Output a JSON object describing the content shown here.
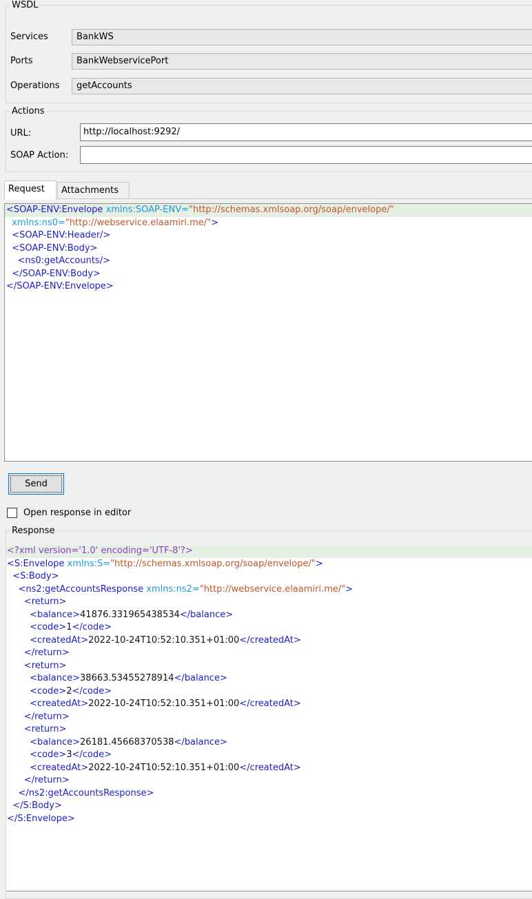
{
  "wsdl": {
    "legend": "WSDL",
    "services_label": "Services",
    "services_value": "BankWS",
    "ports_label": "Ports",
    "ports_value": "BankWebservicePort",
    "operations_label": "Operations",
    "operations_value": "getAccounts"
  },
  "actions": {
    "legend": "Actions",
    "url_label": "URL:",
    "url_value": "http://localhost:9292/",
    "soap_action_label": "SOAP Action:",
    "soap_action_value": ""
  },
  "tabs": [
    {
      "label": "Request",
      "selected": true
    },
    {
      "label": "Attachments",
      "selected": false
    }
  ],
  "request": {
    "lines": [
      [
        {
          "t": "tg",
          "v": "<SOAP-ENV:Envelope "
        },
        {
          "t": "at",
          "v": "xmlns:SOAP-ENV="
        },
        {
          "t": "vl",
          "v": "\"http://schemas.xmlsoap.org/soap/envelope/\""
        }
      ],
      [
        {
          "t": "tx",
          "v": "  "
        },
        {
          "t": "at",
          "v": "xmlns:ns0="
        },
        {
          "t": "vl",
          "v": "\"http://webservice.elaamiri.me/\""
        },
        {
          "t": "tg",
          "v": ">"
        }
      ],
      [
        {
          "t": "tx",
          "v": "  "
        },
        {
          "t": "tg",
          "v": "<SOAP-ENV:Header/>"
        }
      ],
      [
        {
          "t": "tx",
          "v": "  "
        },
        {
          "t": "tg",
          "v": "<SOAP-ENV:Body>"
        }
      ],
      [
        {
          "t": "tx",
          "v": "    "
        },
        {
          "t": "tg",
          "v": "<ns0:getAccounts/>"
        }
      ],
      [
        {
          "t": "tx",
          "v": "  "
        },
        {
          "t": "tg",
          "v": "</SOAP-ENV:Body>"
        }
      ],
      [
        {
          "t": "tg",
          "v": "</SOAP-ENV:Envelope>"
        }
      ]
    ]
  },
  "send_button": "Send",
  "open_in_editor": {
    "label": "Open response in editor",
    "checked": false
  },
  "response": {
    "legend": "Response",
    "lines": [
      [
        {
          "t": "pi",
          "v": "<?xml version='1.0' encoding='UTF-8'?>"
        }
      ],
      [
        {
          "t": "tg",
          "v": "<S:Envelope "
        },
        {
          "t": "at",
          "v": "xmlns:S="
        },
        {
          "t": "vl",
          "v": "\"http://schemas.xmlsoap.org/soap/envelope/\""
        },
        {
          "t": "tg",
          "v": ">"
        }
      ],
      [
        {
          "t": "tx",
          "v": "  "
        },
        {
          "t": "tg",
          "v": "<S:Body>"
        }
      ],
      [
        {
          "t": "tx",
          "v": "    "
        },
        {
          "t": "tg",
          "v": "<ns2:getAccountsResponse "
        },
        {
          "t": "at",
          "v": "xmlns:ns2="
        },
        {
          "t": "vl",
          "v": "\"http://webservice.elaamiri.me/\""
        },
        {
          "t": "tg",
          "v": ">"
        }
      ],
      [
        {
          "t": "tx",
          "v": "      "
        },
        {
          "t": "tg",
          "v": "<return>"
        }
      ],
      [
        {
          "t": "tx",
          "v": "        "
        },
        {
          "t": "tg",
          "v": "<balance>"
        },
        {
          "t": "tx",
          "v": "41876.331965438534"
        },
        {
          "t": "tg",
          "v": "</balance>"
        }
      ],
      [
        {
          "t": "tx",
          "v": "        "
        },
        {
          "t": "tg",
          "v": "<code>"
        },
        {
          "t": "tx",
          "v": "1"
        },
        {
          "t": "tg",
          "v": "</code>"
        }
      ],
      [
        {
          "t": "tx",
          "v": "        "
        },
        {
          "t": "tg",
          "v": "<createdAt>"
        },
        {
          "t": "tx",
          "v": "2022-10-24T10:52:10.351+01:00"
        },
        {
          "t": "tg",
          "v": "</createdAt>"
        }
      ],
      [
        {
          "t": "tx",
          "v": "      "
        },
        {
          "t": "tg",
          "v": "</return>"
        }
      ],
      [
        {
          "t": "tx",
          "v": "      "
        },
        {
          "t": "tg",
          "v": "<return>"
        }
      ],
      [
        {
          "t": "tx",
          "v": "        "
        },
        {
          "t": "tg",
          "v": "<balance>"
        },
        {
          "t": "tx",
          "v": "38663.53455278914"
        },
        {
          "t": "tg",
          "v": "</balance>"
        }
      ],
      [
        {
          "t": "tx",
          "v": "        "
        },
        {
          "t": "tg",
          "v": "<code>"
        },
        {
          "t": "tx",
          "v": "2"
        },
        {
          "t": "tg",
          "v": "</code>"
        }
      ],
      [
        {
          "t": "tx",
          "v": "        "
        },
        {
          "t": "tg",
          "v": "<createdAt>"
        },
        {
          "t": "tx",
          "v": "2022-10-24T10:52:10.351+01:00"
        },
        {
          "t": "tg",
          "v": "</createdAt>"
        }
      ],
      [
        {
          "t": "tx",
          "v": "      "
        },
        {
          "t": "tg",
          "v": "</return>"
        }
      ],
      [
        {
          "t": "tx",
          "v": "      "
        },
        {
          "t": "tg",
          "v": "<return>"
        }
      ],
      [
        {
          "t": "tx",
          "v": "        "
        },
        {
          "t": "tg",
          "v": "<balance>"
        },
        {
          "t": "tx",
          "v": "26181.45668370538"
        },
        {
          "t": "tg",
          "v": "</balance>"
        }
      ],
      [
        {
          "t": "tx",
          "v": "        "
        },
        {
          "t": "tg",
          "v": "<code>"
        },
        {
          "t": "tx",
          "v": "3"
        },
        {
          "t": "tg",
          "v": "</code>"
        }
      ],
      [
        {
          "t": "tx",
          "v": "        "
        },
        {
          "t": "tg",
          "v": "<createdAt>"
        },
        {
          "t": "tx",
          "v": "2022-10-24T10:52:10.351+01:00"
        },
        {
          "t": "tg",
          "v": "</createdAt>"
        }
      ],
      [
        {
          "t": "tx",
          "v": "      "
        },
        {
          "t": "tg",
          "v": "</return>"
        }
      ],
      [
        {
          "t": "tx",
          "v": "    "
        },
        {
          "t": "tg",
          "v": "</ns2:getAccountsResponse>"
        }
      ],
      [
        {
          "t": "tx",
          "v": "  "
        },
        {
          "t": "tg",
          "v": "</S:Body>"
        }
      ],
      [
        {
          "t": "tg",
          "v": "</S:Envelope>"
        }
      ]
    ]
  },
  "colors": {
    "tag": "#1c1cc6",
    "attribute": "#1e9bd0",
    "value": "#c0562a",
    "processing_instruction": "#8a3fbf",
    "current_line_highlight": "#e6efe3",
    "button_focus": "#0078d7"
  }
}
